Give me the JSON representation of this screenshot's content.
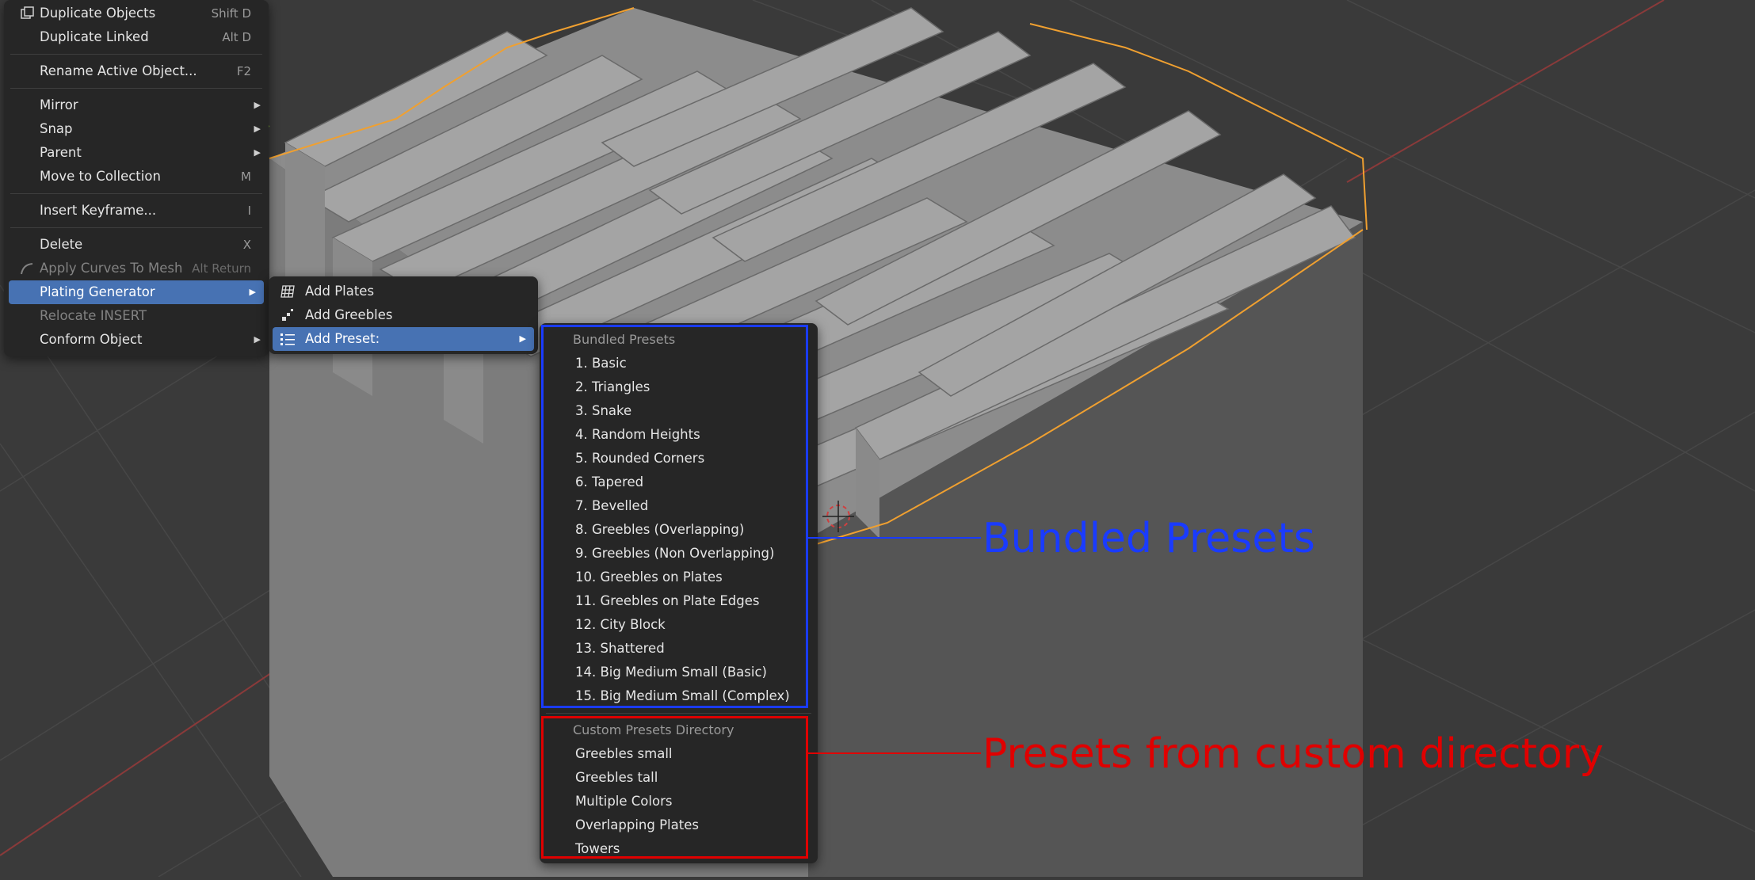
{
  "colors": {
    "viewport_bg": "#3a3a3a",
    "menu_bg": "#262626",
    "highlight": "#4772b3",
    "selection_outline": "#f0a030",
    "annotation_blue": "#1a3bff",
    "annotation_red": "#e00000"
  },
  "object_menu": {
    "items": [
      {
        "label": "Duplicate Objects",
        "shortcut": "Shift D",
        "icon": "duplicate-icon"
      },
      {
        "label": "Duplicate Linked",
        "shortcut": "Alt D"
      },
      {
        "label": "Rename Active Object...",
        "shortcut": "F2"
      },
      {
        "label": "Mirror",
        "submenu": true
      },
      {
        "label": "Snap",
        "submenu": true
      },
      {
        "label": "Parent",
        "submenu": true
      },
      {
        "label": "Move to Collection",
        "shortcut": "M"
      },
      {
        "label": "Insert Keyframe...",
        "shortcut": "I"
      },
      {
        "label": "Delete",
        "shortcut": "X"
      },
      {
        "label": "Apply Curves To Mesh",
        "shortcut": "Alt Return",
        "disabled": true,
        "icon": "curves-icon"
      },
      {
        "label": "Plating Generator",
        "submenu": true,
        "active": true
      },
      {
        "label": "Relocate INSERT",
        "disabled": true
      },
      {
        "label": "Conform Object",
        "submenu": true
      }
    ]
  },
  "plating_menu": {
    "items": [
      {
        "label": "Add Plates",
        "icon": "grid-plane-icon"
      },
      {
        "label": "Add Greebles",
        "icon": "greeble-icon"
      },
      {
        "label": "Add Preset:",
        "submenu": true,
        "active": true,
        "icon": "list-icon"
      }
    ]
  },
  "preset_menu": {
    "bundled_header": "Bundled Presets",
    "bundled": [
      "1. Basic",
      "2. Triangles",
      "3. Snake",
      "4. Random Heights",
      "5. Rounded Corners",
      "6. Tapered",
      "7. Bevelled",
      "8. Greebles (Overlapping)",
      "9. Greebles (Non Overlapping)",
      "10. Greebles on Plates",
      "11. Greebles on Plate Edges",
      "12. City Block",
      "13. Shattered",
      "14. Big Medium Small (Basic)",
      "15. Big Medium Small (Complex)"
    ],
    "custom_header": "Custom Presets Directory",
    "custom": [
      "Greebles small",
      "Greebles tall",
      "Multiple Colors",
      "Overlapping Plates",
      "Towers"
    ]
  },
  "annotations": {
    "bundled_label": "Bundled Presets",
    "custom_label": "Presets from custom directory"
  }
}
